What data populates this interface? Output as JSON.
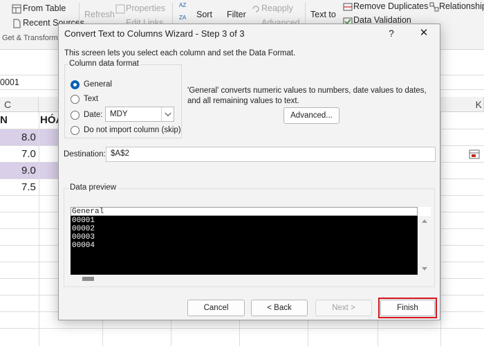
{
  "ribbon": {
    "from_table": "From Table",
    "refresh": "Refresh",
    "properties": "Properties",
    "sort": "Sort",
    "filter": "Filter",
    "reapply": "Reapply",
    "text_to": "Text to",
    "remove_duplicates": "Remove Duplicates",
    "relationships": "Relationship",
    "recent_sources": "Recent Sources",
    "edit_links": "Edit Links",
    "advanced": "Advanced",
    "data_validation": "Data Validation",
    "group_get_transform": "Get & Transform"
  },
  "formula_bar": {
    "name_box": "0001"
  },
  "sheet": {
    "col_c": "C",
    "col_k": "K",
    "header_n": "N",
    "header_hoa": "HÓA",
    "values": [
      "8.0",
      "7.0",
      "9.0",
      "7.5"
    ]
  },
  "dialog": {
    "title": "Convert Text to Columns Wizard - Step 3 of 3",
    "help": "?",
    "close": "✕",
    "description": "This screen lets you select each column and set the Data Format.",
    "format_group": {
      "legend": "Column data format",
      "options": [
        "General",
        "Text",
        "Date:",
        "Do not import column (skip)"
      ],
      "selected": "General",
      "date_format": "MDY"
    },
    "format_explain": "'General' converts numeric values to numbers, date values to dates, and all remaining values to text.",
    "advanced_button": "Advanced...",
    "destination": {
      "label": "Destination:",
      "value": "$A$2"
    },
    "preview": {
      "legend": "Data preview",
      "column_header": "General",
      "rows": [
        "00001",
        "00002",
        "00003",
        "00004"
      ]
    },
    "buttons": {
      "cancel": "Cancel",
      "back": "< Back",
      "next": "Next >",
      "finish": "Finish"
    }
  },
  "colors": {
    "accent": "#0a5fb4",
    "highlight": "#d3141c",
    "cell_fill": "#d9cfe8"
  }
}
